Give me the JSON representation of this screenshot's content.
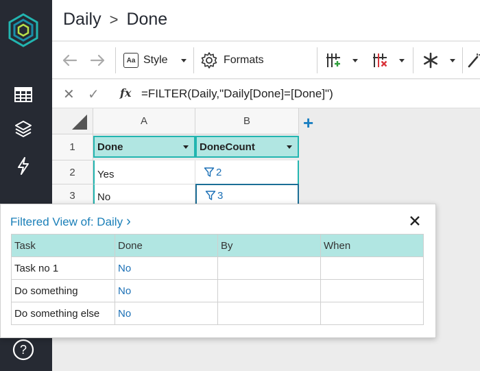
{
  "colors": {
    "sidebar_bg": "#262a33",
    "header_cell": "#b1e6e2",
    "accent": "#1a7fc1",
    "selection": "#22b5b0"
  },
  "breadcrumb": {
    "parent": "Daily",
    "separator": ">",
    "current": "Done"
  },
  "toolbar": {
    "style_label": "Style",
    "style_icon_text": "Aa",
    "formats_label": "Formats",
    "icons": [
      "undo-icon",
      "redo-icon",
      "style-icon",
      "gear-icon",
      "insert-column-icon",
      "delete-column-icon",
      "snowflake-icon",
      "magic-wand-icon"
    ]
  },
  "formula_bar": {
    "cancel_glyph": "✕",
    "accept_glyph": "✓",
    "fx_label": "fx",
    "formula": "=FILTER(Daily,\"Daily[Done]=[Done]\")"
  },
  "grid": {
    "columns": [
      "A",
      "B"
    ],
    "rows": [
      "1",
      "2",
      "3"
    ],
    "header_row": {
      "a": "Done",
      "b": "DoneCount"
    },
    "row2": {
      "a": "Yes",
      "b": "2"
    },
    "row3": {
      "a": "No",
      "b": "3"
    },
    "add_column_glyph": "+"
  },
  "popup": {
    "title": "Filtered View of: Daily",
    "chevron": "›",
    "headers": [
      "Task",
      "Done",
      "By",
      "When"
    ],
    "rows": [
      {
        "task": "Task no 1",
        "done": "No",
        "by": "",
        "when": ""
      },
      {
        "task": "Do something",
        "done": "No",
        "by": "",
        "when": ""
      },
      {
        "task": "Do something else",
        "done": "No",
        "by": "",
        "when": ""
      }
    ]
  },
  "help_glyph": "?"
}
